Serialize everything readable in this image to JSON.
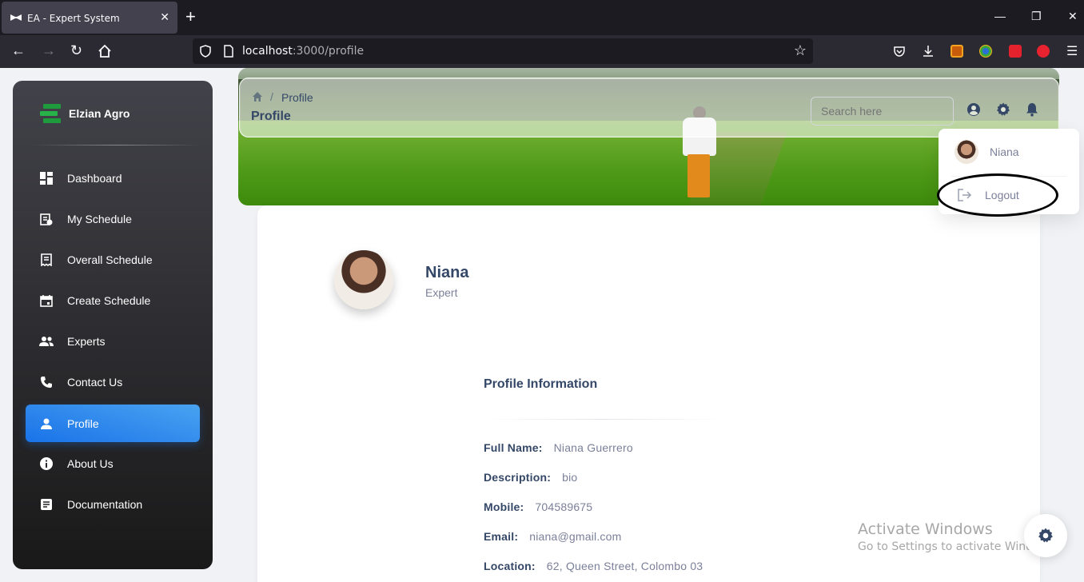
{
  "browser": {
    "tab_title": "EA - Expert System",
    "url_host": "localhost",
    "url_rest": ":3000/profile"
  },
  "sidebar": {
    "brand": "Elzian Agro",
    "items": [
      {
        "label": "Dashboard",
        "icon": "dashboard-icon"
      },
      {
        "label": "My Schedule",
        "icon": "schedule-icon"
      },
      {
        "label": "Overall Schedule",
        "icon": "receipt-icon"
      },
      {
        "label": "Create Schedule",
        "icon": "calendar-icon"
      },
      {
        "label": "Experts",
        "icon": "people-icon"
      },
      {
        "label": "Contact Us",
        "icon": "phone-icon"
      },
      {
        "label": "Profile",
        "icon": "person-icon",
        "active": true
      },
      {
        "label": "About Us",
        "icon": "info-icon"
      },
      {
        "label": "Documentation",
        "icon": "article-icon"
      }
    ]
  },
  "header": {
    "breadcrumb_current": "Profile",
    "title": "Profile",
    "search_placeholder": "Search here"
  },
  "account_menu": {
    "user_name": "Niana",
    "logout_label": "Logout"
  },
  "profile": {
    "name": "Niana",
    "role": "Expert",
    "info_title": "Profile Information",
    "fields": [
      {
        "key": "Full Name:",
        "value": "Niana Guerrero"
      },
      {
        "key": "Description:",
        "value": "bio"
      },
      {
        "key": "Mobile:",
        "value": "704589675"
      },
      {
        "key": "Email:",
        "value": "niana@gmail.com"
      },
      {
        "key": "Location:",
        "value": "62, Queen Street, Colombo 03"
      }
    ]
  },
  "watermark": {
    "line1": "Activate Windows",
    "line2": "Go to Settings to activate Windows."
  },
  "colors": {
    "accent": "#1a73e8",
    "text_dark": "#344767",
    "text_muted": "#7b809a"
  }
}
